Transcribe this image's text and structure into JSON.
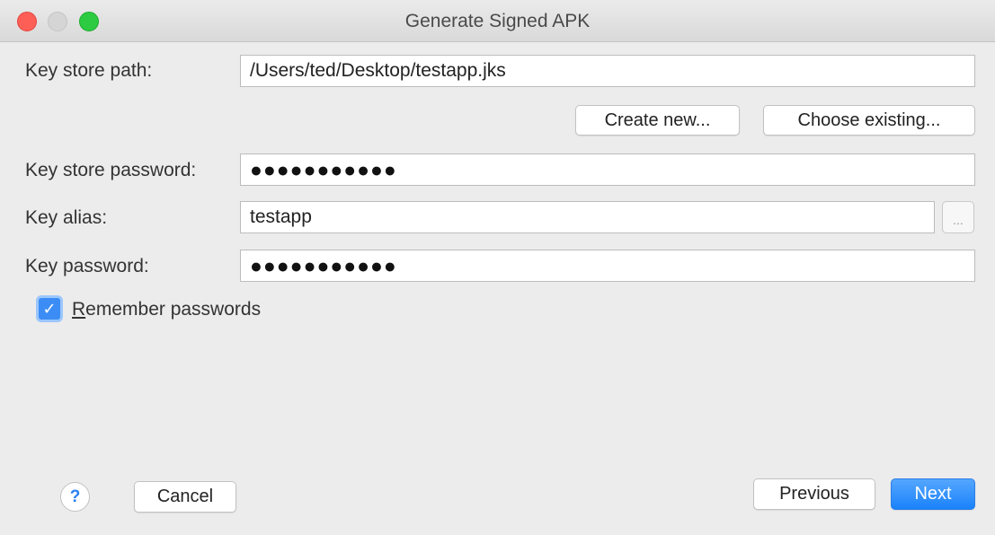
{
  "window": {
    "title": "Generate Signed APK"
  },
  "form": {
    "key_store_path": {
      "label": "Key store path:",
      "value": "/Users/ted/Desktop/testapp.jks"
    },
    "create_new_label": "Create new...",
    "choose_existing_label": "Choose existing...",
    "key_store_password": {
      "label": "Key store password:",
      "value": "●●●●●●●●●●●"
    },
    "key_alias": {
      "label": "Key alias:",
      "value": "testapp",
      "browse_label": "..."
    },
    "key_password": {
      "label": "Key password:",
      "value": "●●●●●●●●●●●"
    },
    "remember": {
      "label_first": "R",
      "label_rest": "emember passwords",
      "checked": true
    }
  },
  "footer": {
    "help_label": "?",
    "cancel_label": "Cancel",
    "previous_label": "Previous",
    "next_label": "Next"
  },
  "colors": {
    "accent": "#1a82fb",
    "close": "#fd5f57",
    "zoom": "#2ccb41"
  }
}
